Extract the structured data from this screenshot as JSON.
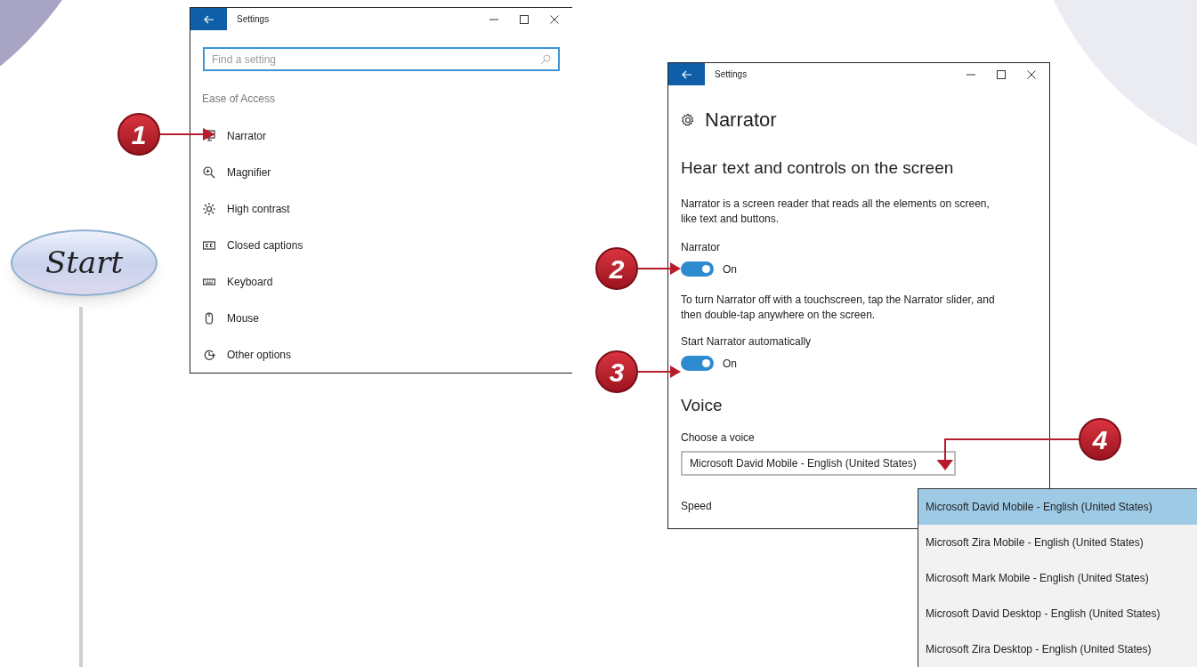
{
  "start_badge": "Start",
  "callouts": [
    {
      "number": "1"
    },
    {
      "number": "2"
    },
    {
      "number": "3"
    },
    {
      "number": "4"
    }
  ],
  "settings_window": {
    "title": "Settings",
    "search": {
      "placeholder": "Find a setting"
    },
    "section": "Ease of Access",
    "items": [
      {
        "label": "Narrator"
      },
      {
        "label": "Magnifier"
      },
      {
        "label": "High contrast"
      },
      {
        "label": "Closed captions"
      },
      {
        "label": "Keyboard"
      },
      {
        "label": "Mouse"
      },
      {
        "label": "Other options"
      }
    ]
  },
  "narrator_window": {
    "title": "Settings",
    "heading": "Narrator",
    "subheading": "Hear text and controls on the screen",
    "description": "Narrator is a screen reader that reads all the elements on screen, like text and buttons.",
    "toggles": [
      {
        "label": "Narrator",
        "on": true,
        "state_text": "On"
      },
      {
        "label": "Start Narrator automatically",
        "on": true,
        "state_text": "On"
      }
    ],
    "note": "To turn Narrator off with a touchscreen, tap the Narrator slider, and then double-tap anywhere on the screen.",
    "voice_heading": "Voice",
    "voice_label": "Choose a voice",
    "voice_value": "Microsoft David Mobile - English (United States)",
    "speed_label": "Speed"
  },
  "voice_options": [
    {
      "label": "Microsoft David Mobile - English (United States)",
      "selected": true
    },
    {
      "label": "Microsoft Zira Mobile - English (United States)",
      "selected": false
    },
    {
      "label": "Microsoft Mark Mobile - English (United States)",
      "selected": false
    },
    {
      "label": "Microsoft David Desktop - English (United States)",
      "selected": false
    },
    {
      "label": "Microsoft Zira Desktop - English (United States)",
      "selected": false
    }
  ]
}
